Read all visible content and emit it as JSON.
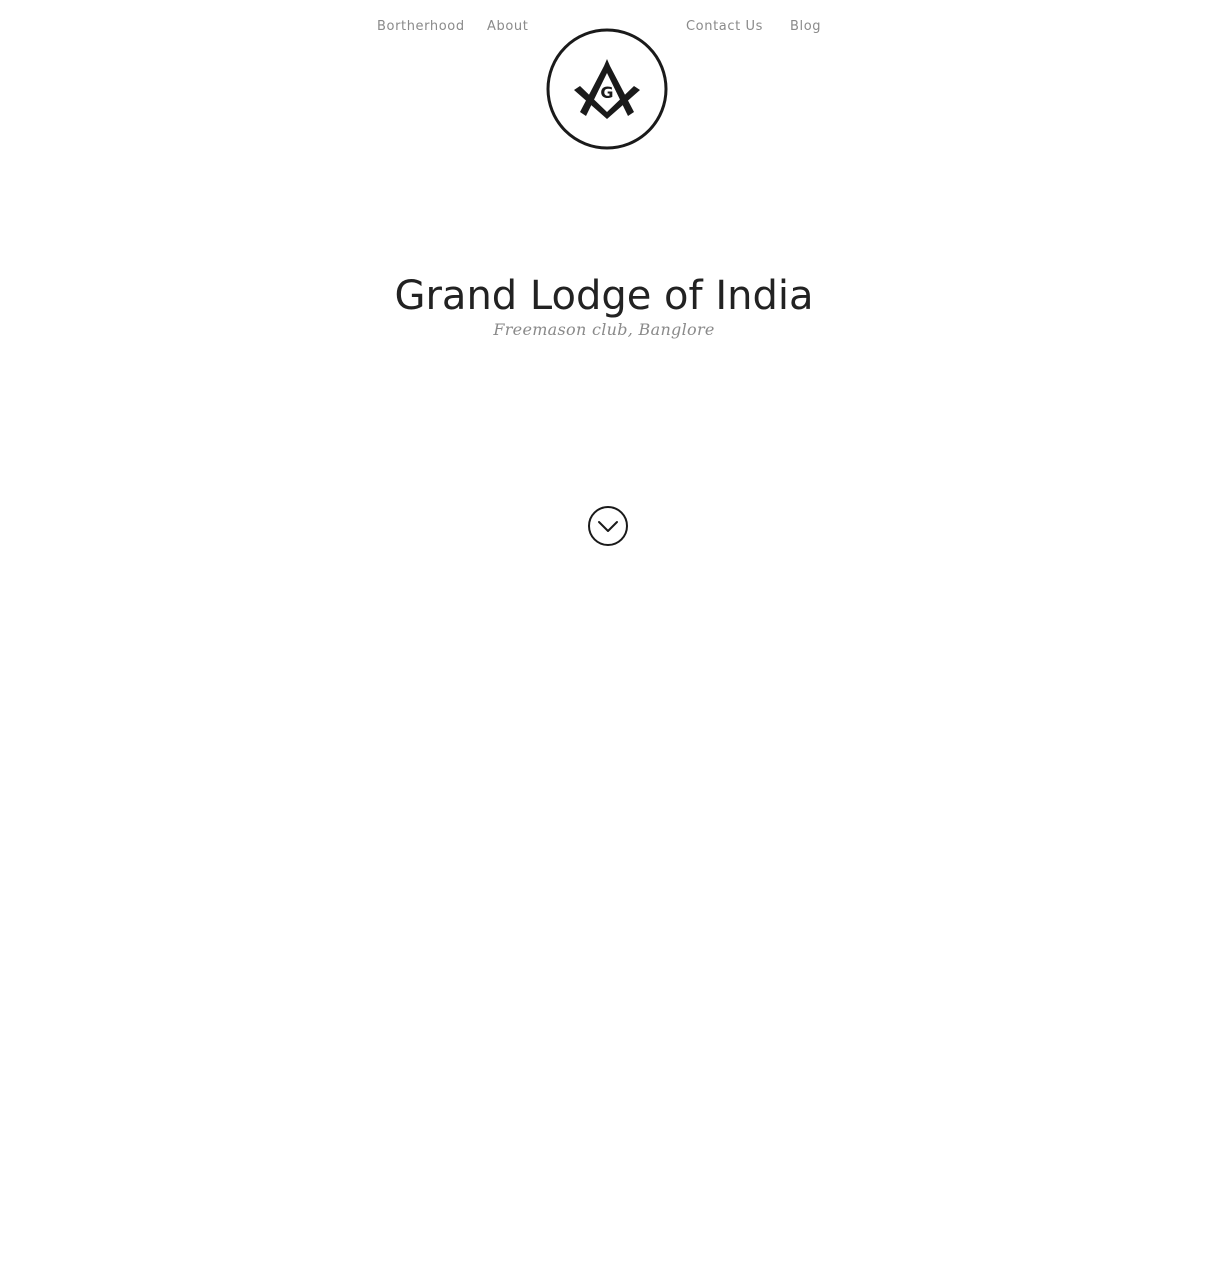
{
  "nav": {
    "items": [
      {
        "label": "Bortherhood"
      },
      {
        "label": "About"
      },
      {
        "label": "Contact Us"
      },
      {
        "label": "Blog"
      }
    ]
  },
  "logo": {
    "icon": "square-and-compasses-icon",
    "letter": "G"
  },
  "hero": {
    "title": "Grand Lodge of India",
    "subtitle": "Freemason club, Banglore"
  },
  "scroll": {
    "icon": "chevron-down-circle-icon"
  },
  "colors": {
    "background": "#ffffff",
    "text_dark": "#222222",
    "text_muted": "#8a8a8a"
  }
}
